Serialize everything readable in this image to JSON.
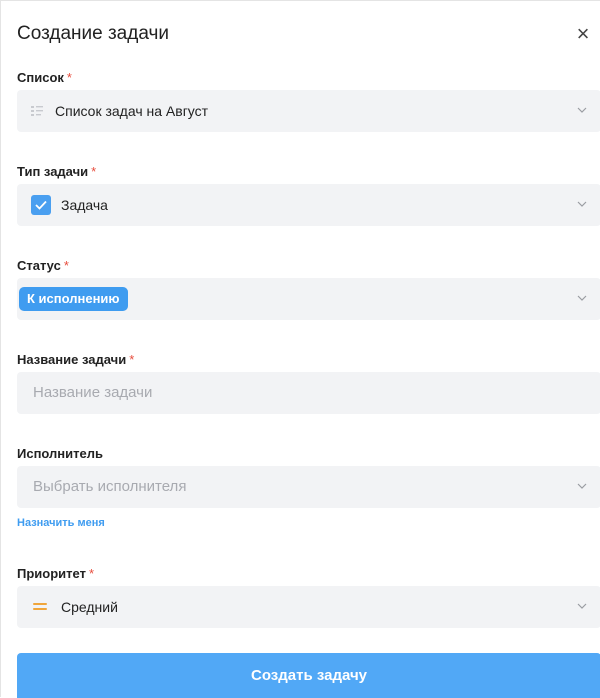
{
  "dialog": {
    "title": "Создание задачи",
    "close_icon": "close-icon"
  },
  "fields": {
    "list": {
      "label": "Список",
      "required": "*",
      "value": "Список задач на Август",
      "icon": "list-icon"
    },
    "task_type": {
      "label": "Тип задачи",
      "required": "*",
      "value": "Задача",
      "icon": "checkbox-icon"
    },
    "status": {
      "label": "Статус",
      "required": "*",
      "value": "К исполнению",
      "badge_color": "#3f9cf0"
    },
    "task_name": {
      "label": "Название задачи",
      "required": "*",
      "placeholder": "Название задачи"
    },
    "assignee": {
      "label": "Исполнитель",
      "placeholder": "Выбрать исполнителя",
      "assign_me_link": "Назначить меня"
    },
    "priority": {
      "label": "Приоритет",
      "required": "*",
      "value": "Средний",
      "icon": "priority-medium-icon",
      "icon_color": "#f0a53b"
    }
  },
  "submit": {
    "label": "Создать задачу",
    "color": "#51a8f6"
  }
}
